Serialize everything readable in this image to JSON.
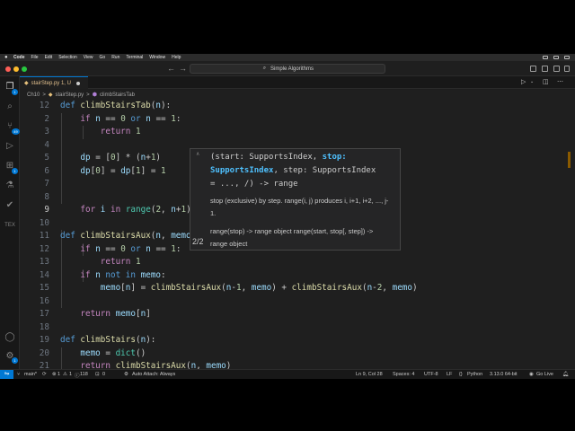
{
  "menubar": {
    "apple": "",
    "items": [
      "Code",
      "File",
      "Edit",
      "Selection",
      "View",
      "Go",
      "Run",
      "Terminal",
      "Window",
      "Help"
    ]
  },
  "titlebar": {
    "search_text": "Simple Algorithms",
    "search_icon": "search-icon"
  },
  "activity_bar": {
    "items": [
      "files-icon",
      "search-icon",
      "source-control-icon",
      "run-debug-icon",
      "extensions-icon",
      "testing-icon",
      "check-icon",
      "tex-icon"
    ],
    "tex_label": "TEX",
    "badges": {
      "explorer": "1",
      "source_control": "49",
      "extensions": "1",
      "settings": "1"
    }
  },
  "tabs": [
    {
      "label": "stairStep.py 1, U",
      "modified": true
    }
  ],
  "breadcrumbs": {
    "folder": "Ch10",
    "file": "stairStep.py",
    "symbol": "climbStairsTab",
    "separator": ">"
  },
  "editor": {
    "current_line": 9,
    "lines": [
      {
        "n": "12"
      },
      {
        "n": "2"
      },
      {
        "n": "3"
      },
      {
        "n": "4"
      },
      {
        "n": "5"
      },
      {
        "n": "6"
      },
      {
        "n": "7"
      },
      {
        "n": "8"
      },
      {
        "n": "9"
      },
      {
        "n": "10"
      },
      {
        "n": "11"
      },
      {
        "n": "12"
      },
      {
        "n": "13"
      },
      {
        "n": "14"
      },
      {
        "n": "15"
      },
      {
        "n": "16"
      },
      {
        "n": "17"
      },
      {
        "n": "18"
      },
      {
        "n": "19"
      },
      {
        "n": "20"
      },
      {
        "n": "21"
      }
    ]
  },
  "hover": {
    "signature_parts": [
      "(start: SupportsIndex, ",
      "stop:",
      " SupportsIndex",
      ", step: SupportsIndex = ..., /) -> range"
    ],
    "doc1": "stop (exclusive) by step. range(i, j) produces i, i+1, i+2, ..., j-1.",
    "doc2": "range(stop) -> range object range(start, stop[, step]) -> range object",
    "pager": "2/2"
  },
  "statusbar": {
    "branch": "main*",
    "sync_icon": "sync-icon",
    "errors": "1",
    "warnings": "1",
    "info": "118",
    "ports": "0",
    "auto_attach": "Auto Attach: Always",
    "position": "Ln 9, Col 28",
    "spaces": "Spaces: 4",
    "encoding": "UTF-8",
    "eol": "LF",
    "language": "Python",
    "interpreter": "3.13.0 64-bit",
    "go_live": "Go Live"
  },
  "colors": {
    "accent": "#0078d4",
    "keyword": "#c586c0",
    "function": "#dcdcaa",
    "number": "#b5cea8"
  }
}
